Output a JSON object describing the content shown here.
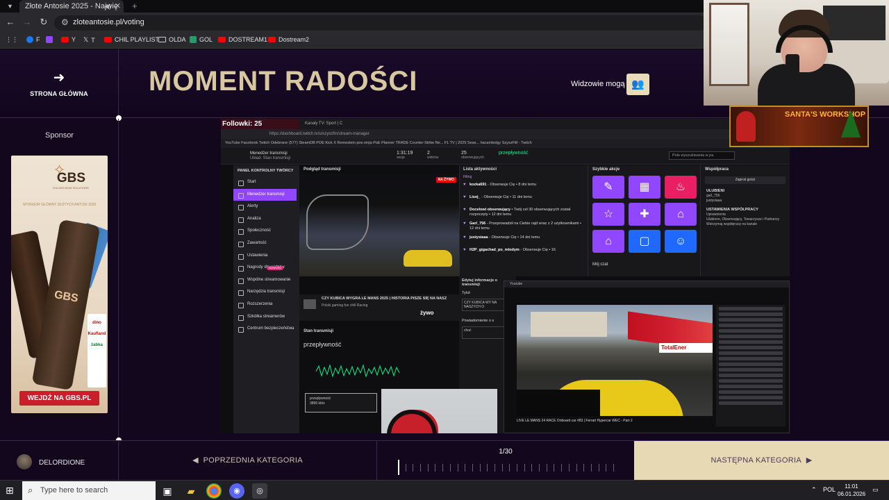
{
  "browser": {
    "tab_title": "Złote Antosie 2025 - Najwię",
    "tab_close": "✕",
    "new_tab": "+",
    "url": "zloteantosie.pl/voting",
    "bookmarks": [
      {
        "label": "F",
        "icon": "facebook-icon"
      },
      {
        "label": "",
        "icon": "twitch-icon"
      },
      {
        "label": "",
        "icon": "youtube-icon"
      },
      {
        "label": "Y",
        "icon": "youtube-icon"
      },
      {
        "label": "T",
        "icon": "x-icon"
      },
      {
        "label": "CHIL PLAYLIST",
        "icon": "youtube-icon"
      },
      {
        "label": "OLDA",
        "icon": "folder-icon"
      },
      {
        "label": "GOL",
        "icon": "gol-icon"
      },
      {
        "label": "DOSTREAM1",
        "icon": "youtube-icon"
      },
      {
        "label": "Dostream2",
        "icon": "youtube-icon"
      }
    ]
  },
  "header": {
    "home_label": "STRONA GŁÓWNA",
    "title": "MOMENT RADOŚCI",
    "viewers_label": "Widzowie mogą"
  },
  "sidebar": {
    "sponsor_label": "Sponsor",
    "ad": {
      "brand": "GBS",
      "brand_sub": "GOLDEN BOW SOLUTIONS",
      "tagline": "SPONSOR GŁÓWNY ZŁOTYCH ANTOSI 2025",
      "can_label": "GBS",
      "retailers": [
        "dino",
        "Kaufland",
        "żabka"
      ],
      "cta": "WEJDŹ NA GBS.PL"
    }
  },
  "media": {
    "followers": "Followki: 25",
    "mini_tab": "Kanały TV: Sport | C",
    "mini_url": "https://dashboard.twitch.tv/u/szyszfm/stream-manager",
    "mini_bookmarks": "YouTube   Facebook   Twitch   Odebrane (577)   SteamDB   POE   Kick   X   Remestein   poe.ninja   PoE Planner   TRADE   Counter-Strike Ne...   F1 TV | 2025 Seas...   hacambolgy   SzyszFM - Twitch",
    "manager_title": "Menedżer transmisji",
    "manager_sub": "Układ: Stan transmisji",
    "stats": [
      {
        "value": "1:31:19",
        "label": "sesja"
      },
      {
        "value": "2",
        "label": "widzów"
      },
      {
        "value": "25",
        "label": "obserwujących"
      },
      {
        "value": "przepływność",
        "label": "przepływność"
      }
    ],
    "search_placeholder": "Pole wyszukiwania w pa",
    "nav_header": "PANEL KONTROLNY TWÓRCY",
    "nav": [
      {
        "label": "Start",
        "active": false
      },
      {
        "label": "Menedżer transmisji",
        "active": true
      },
      {
        "label": "Alerty",
        "active": false
      },
      {
        "label": "Analiza",
        "active": false
      },
      {
        "label": "Społeczność",
        "active": false
      },
      {
        "label": "Zawartość",
        "active": false
      },
      {
        "label": "Ustawienia",
        "active": false
      },
      {
        "label": "Nagrody dla widzów",
        "active": false,
        "badge": "NOWOŚĆ"
      },
      {
        "label": "Wspólne streamowanie",
        "active": false
      },
      {
        "label": "Narzędzia transmisji",
        "active": false
      },
      {
        "label": "Rozszerzenia",
        "active": false
      },
      {
        "label": "Szkółka streamerów",
        "active": false
      },
      {
        "label": "Centrum bezpieczeństwa",
        "active": false
      }
    ],
    "preview_header": "Podgląd transmisji",
    "live_badge": "NA ŻYWO",
    "stream_title": "CZY KUBICA WYGRA LE MANS 2025 | HISTORIA PISZE SIĘ NA NASZ",
    "stream_tags": "Polski   gaming   fun   chill   Racing",
    "zywo": "żywo",
    "status_header": "Stan transmisji",
    "status_bitrate_label": "przepływność",
    "status_box_label": "przepływność",
    "status_box_value": "3896 kb/s",
    "activity_header": "Lista aktywności",
    "activity_filter": "Filtruj",
    "activity": [
      {
        "user": "kozka691",
        "text": " - Obserwuje Cię • 8 dni temu"
      },
      {
        "user": "Lisej_",
        "text": " - Obserwuje Cię • 11 dni temu"
      },
      {
        "user": "Docelowi obserwujący",
        "text": " • Twój cel 30 obserwujących został rozpoczęty • 12 dni temu"
      },
      {
        "user": "Garl_756",
        "text": " - Przeprowadził na Ciebie rajd wraz z 2 użytkownikami • 12 dni temu"
      },
      {
        "user": "justysiaaa",
        "text": " - Obserwuje Cię • 14 dni temu"
      },
      {
        "user": "H2P_gigachad_po_mlodym",
        "text": " - Obserwuje Cię • 16"
      }
    ],
    "quick_header": "Szybkie akcje",
    "quick_actions": [
      {
        "icon": "pencil-icon",
        "glyph": "✎",
        "color": "#9147ff"
      },
      {
        "icon": "clapper-icon",
        "glyph": "▦",
        "color": "#9147ff"
      },
      {
        "icon": "raid-icon",
        "glyph": "♨",
        "color": "#e91e63"
      },
      {
        "icon": "star-icon",
        "glyph": "☆",
        "color": "#9147ff"
      },
      {
        "icon": "add-user-icon",
        "glyph": "✚",
        "color": "#9147ff"
      },
      {
        "icon": "ad-icon",
        "glyph": "⌂",
        "color": "#9147ff"
      },
      {
        "icon": "ad-icon",
        "glyph": "⌂",
        "color": "#9147ff"
      },
      {
        "icon": "chat-icon",
        "glyph": "▢",
        "color": "#1f69ff"
      },
      {
        "icon": "emote-icon",
        "glyph": "☺",
        "color": "#1f69ff"
      }
    ],
    "my_chat": "Mój czat",
    "collab_header": "Współpraca",
    "collab_btn": "Zaproś gości",
    "favorites_label": "ULUBIENI",
    "favorites": [
      "garl_756",
      "justysiaaa"
    ],
    "collab_settings_label": "USTAWIENIA WSPÓŁPRACY",
    "collab_settings_sub": "Uprawnienia",
    "collab_settings_text": "Ulubione, Obserwujący, Towarzysze i Partnerzy",
    "collab_pause": "Wstrzymaj współpracę na kanale",
    "edit_info": "Edytuj informacje o transmisji",
    "edit_title_label": "Tytuł",
    "edit_title_value": "CZY KUBICA WY NA NASZYCH O",
    "notif_label": "Powiadomienie o s",
    "notif_value": "choć",
    "race_caption": "LIVE LE MANS 24 RACE Onboard car #83 | Ferrari Hypercar WEC - Part 2",
    "race_sign": "TotalEner",
    "race_tab": "Youtube"
  },
  "bottom": {
    "username": "DELORDIONE",
    "prev": "PO‌PRZEDNIA KATEGORIA",
    "counter": "1/30",
    "current": 1,
    "total": 30,
    "next": "NASTĘPNA KATEGORIA"
  },
  "overlay": {
    "santa_text": "SANTA'S WORKSHOP"
  },
  "taskbar": {
    "search_placeholder": "Type here to search",
    "lang": "POL",
    "time": "11:01",
    "date": "06.01.2026"
  }
}
